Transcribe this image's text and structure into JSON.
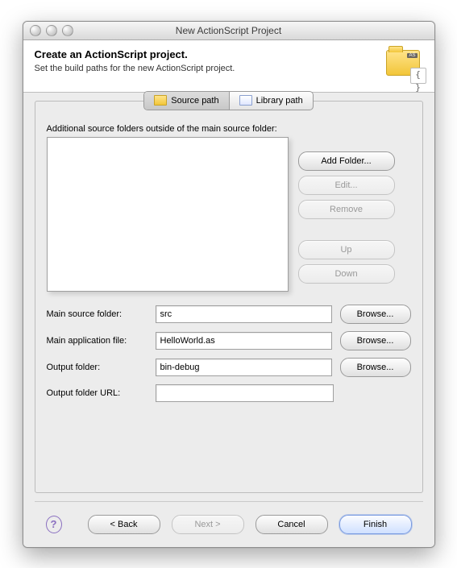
{
  "window": {
    "title": "New ActionScript Project"
  },
  "header": {
    "title": "Create an ActionScript project.",
    "subtitle": "Set the build paths for the new ActionScript project.",
    "folder_tag": "AS",
    "braces": "{ }"
  },
  "tabs": {
    "source": "Source path",
    "library": "Library path"
  },
  "source_section": {
    "list_label": "Additional source folders outside of the main source folder:",
    "buttons": {
      "add": "Add Folder...",
      "edit": "Edit...",
      "remove": "Remove",
      "up": "Up",
      "down": "Down"
    }
  },
  "fields": {
    "main_source_label": "Main source folder:",
    "main_source_value": "src",
    "main_app_label": "Main application file:",
    "main_app_value": "HelloWorld.as",
    "output_label": "Output folder:",
    "output_value": "bin-debug",
    "output_url_label": "Output folder URL:",
    "output_url_value": "",
    "browse": "Browse..."
  },
  "footer": {
    "help": "?",
    "back": "< Back",
    "next": "Next >",
    "cancel": "Cancel",
    "finish": "Finish"
  }
}
